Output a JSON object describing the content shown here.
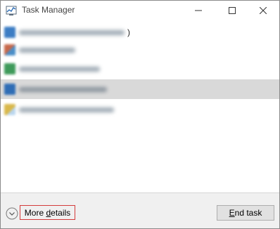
{
  "window": {
    "title": "Task Manager"
  },
  "processes": [
    {
      "icon": "app-icon-blue",
      "color": "#3c7dc4",
      "suffix": ")",
      "selected": false
    },
    {
      "icon": "app-icon-multicolor",
      "color": "#c7684a",
      "suffix": "",
      "selected": false
    },
    {
      "icon": "app-icon-green",
      "color": "#3e9a5a",
      "suffix": "",
      "selected": false
    },
    {
      "icon": "app-icon-blue",
      "color": "#2f6db5",
      "suffix": "",
      "selected": true
    },
    {
      "icon": "app-icon-yellow",
      "color": "#d9b84a",
      "suffix": "",
      "selected": false
    }
  ],
  "footer": {
    "more_details_prefix": "More ",
    "more_details_underlined": "d",
    "more_details_rest": "etails",
    "end_task_underlined": "E",
    "end_task_rest": "nd task"
  },
  "colors": {
    "selection": "#d9d9d9",
    "footer_bg": "#f0f0f0",
    "highlight_border": "#d43b3b"
  }
}
